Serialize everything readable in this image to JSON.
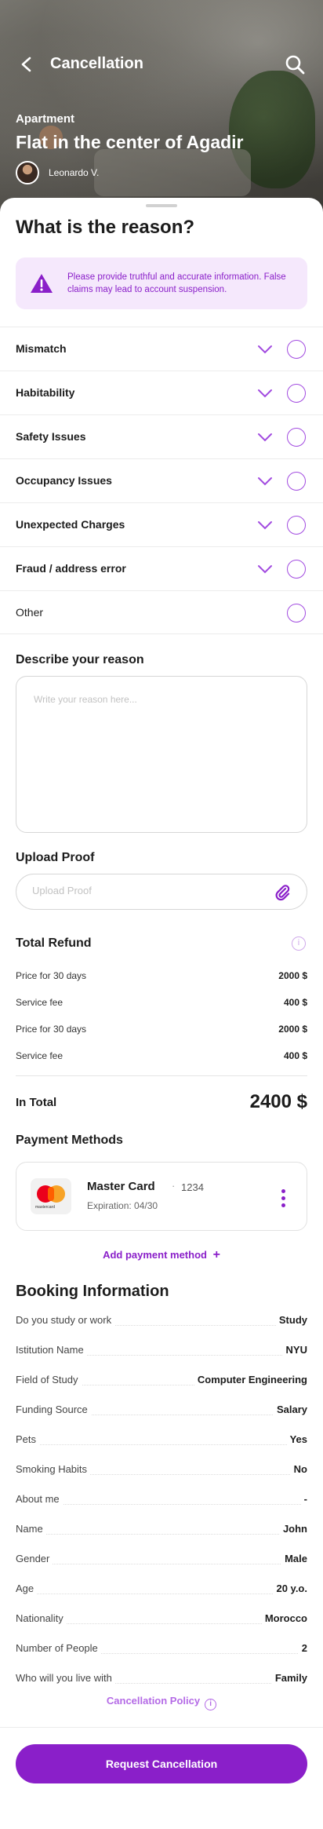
{
  "header": {
    "title": "Cancellation"
  },
  "listing": {
    "type": "Apartment",
    "title": "Flat in the center of Agadir",
    "host": "Leonardo V."
  },
  "reason_section": {
    "title": "What is the reason?",
    "warning": "Please provide truthful and accurate information. False claims may lead to account suspension.",
    "options": [
      {
        "label": "Mismatch",
        "expandable": true
      },
      {
        "label": "Habitability",
        "expandable": true
      },
      {
        "label": "Safety Issues",
        "expandable": true
      },
      {
        "label": "Occupancy Issues",
        "expandable": true
      },
      {
        "label": "Unexpected Charges",
        "expandable": true
      },
      {
        "label": "Fraud / address error",
        "expandable": true
      },
      {
        "label": "Other",
        "expandable": false
      }
    ]
  },
  "describe": {
    "label": "Describe your reason",
    "placeholder": "Write your reason here..."
  },
  "upload": {
    "label": "Upload Proof",
    "placeholder": "Upload Proof"
  },
  "refund": {
    "title": "Total Refund",
    "rows": [
      {
        "label": "Price for 30 days",
        "value": "2000 $"
      },
      {
        "label": "Service fee",
        "value": "400 $"
      },
      {
        "label": "Price for 30 days",
        "value": "2000 $"
      },
      {
        "label": "Service fee",
        "value": "400 $"
      }
    ],
    "total_label": "In Total",
    "total_value": "2400 $"
  },
  "payment": {
    "title": "Payment Methods",
    "card_brand": "Master Card",
    "card_dot": "·",
    "card_last4": "1234",
    "card_expiry": "Expiration: 04/30",
    "logo_text": "mastercard",
    "add_label": "Add payment method",
    "add_icon": "+"
  },
  "booking": {
    "title": "Booking Information",
    "rows": [
      {
        "label": "Do you study or work",
        "value": "Study"
      },
      {
        "label": "Istitution Name",
        "value": "NYU"
      },
      {
        "label": "Field of Study",
        "value": "Computer Engineering"
      },
      {
        "label": "Funding Source",
        "value": "Salary"
      },
      {
        "label": "Pets",
        "value": "Yes"
      },
      {
        "label": "Smoking Habits",
        "value": "No"
      },
      {
        "label": "About me",
        "value": "-"
      },
      {
        "label": "Name",
        "value": "John"
      },
      {
        "label": "Gender",
        "value": "Male"
      },
      {
        "label": "Age",
        "value": "20 y.o."
      },
      {
        "label": "Nationality",
        "value": "Morocco"
      },
      {
        "label": "Number of People",
        "value": "2"
      },
      {
        "label": "Who will you live with",
        "value": "Family"
      }
    ]
  },
  "footer": {
    "policy_label": "Cancellation Policy",
    "info_glyph": "i",
    "cta_label": "Request Cancellation"
  },
  "colors": {
    "accent": "#8a1fc9",
    "accent_light": "#f5e8fc"
  }
}
